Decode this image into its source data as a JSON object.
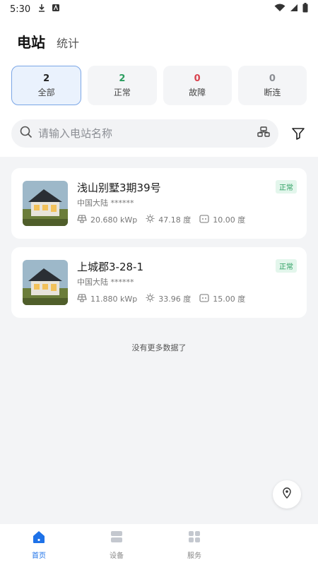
{
  "status_bar": {
    "time": "5:30"
  },
  "header": {
    "tab_active": "电站",
    "tab_other": "统计"
  },
  "filters": [
    {
      "count": "2",
      "label": "全部",
      "color": "#222222"
    },
    {
      "count": "2",
      "label": "正常",
      "color": "#2a9d5f"
    },
    {
      "count": "0",
      "label": "故障",
      "color": "#d9434f"
    },
    {
      "count": "0",
      "label": "断连",
      "color": "#8a8d93"
    }
  ],
  "search": {
    "placeholder": "请输入电站名称"
  },
  "stations": [
    {
      "name": "浅山别墅3期39号",
      "region": "中国大陆 ******",
      "status": "正常",
      "capacity": "20.680 kWp",
      "energy_today": "47.18 度",
      "energy_other": "10.00 度"
    },
    {
      "name": "上城郡3-28-1",
      "region": "中国大陆 ******",
      "status": "正常",
      "capacity": "11.880 kWp",
      "energy_today": "33.96 度",
      "energy_other": "15.00 度"
    }
  ],
  "list_footer": "没有更多数据了",
  "bottom_nav": [
    {
      "label": "首页",
      "icon": "home-icon"
    },
    {
      "label": "设备",
      "icon": "device-icon"
    },
    {
      "label": "服务",
      "icon": "service-icon"
    }
  ],
  "colors": {
    "accent": "#1e72e8",
    "normal": "#2a9d5f",
    "fault": "#d9434f",
    "offline": "#8a8d93"
  }
}
